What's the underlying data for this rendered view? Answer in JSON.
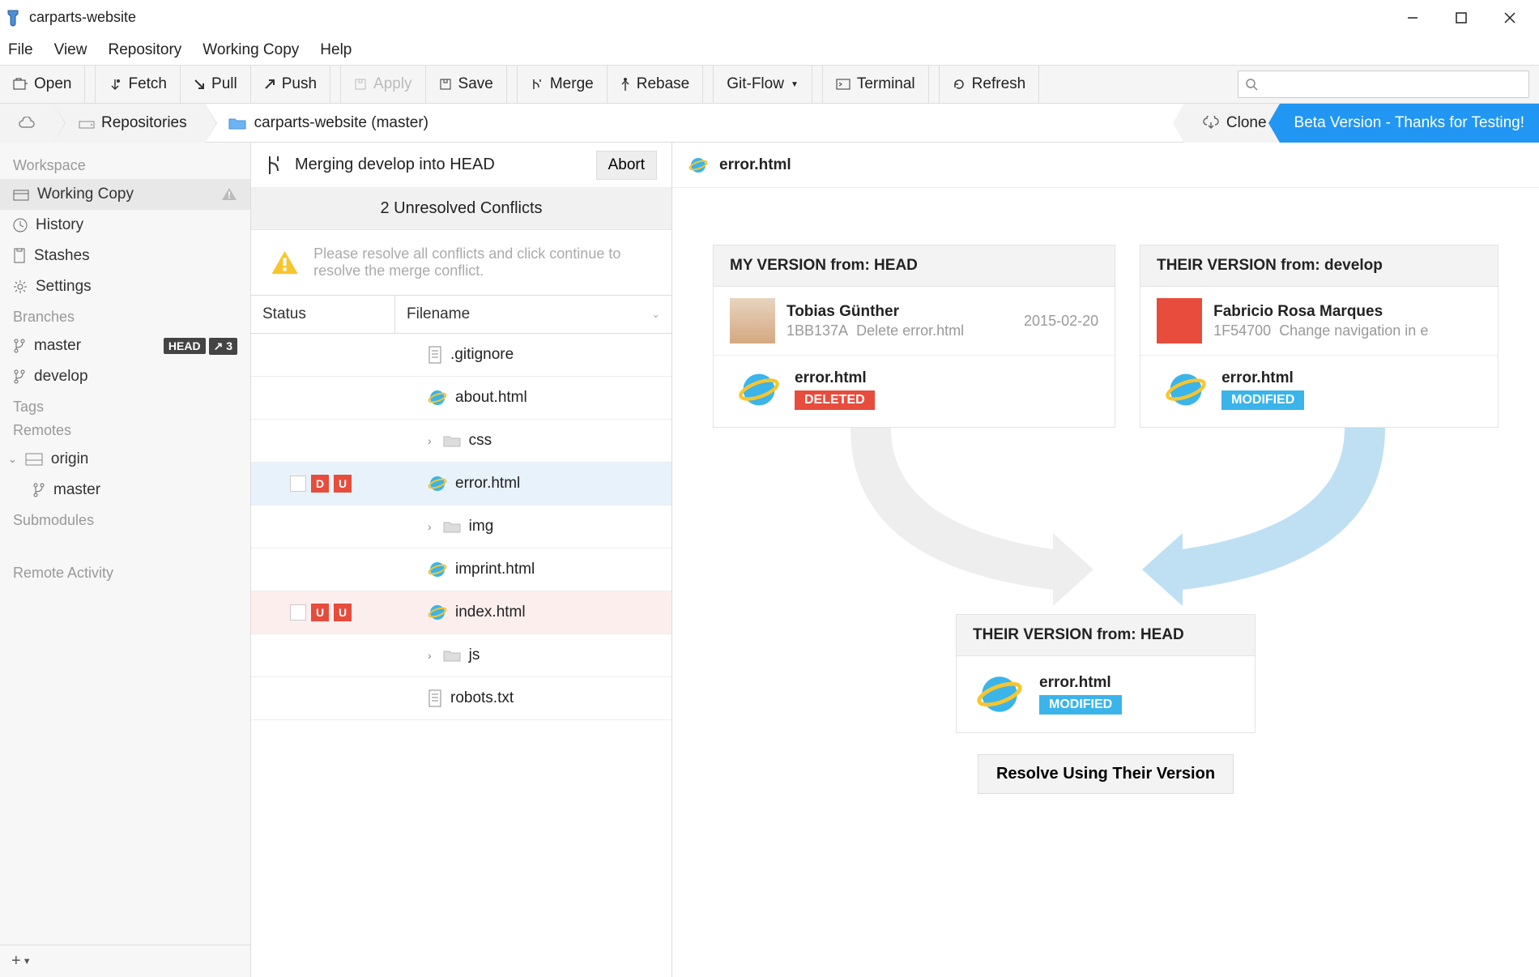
{
  "window": {
    "title": "carparts-website"
  },
  "menu": [
    "File",
    "View",
    "Repository",
    "Working Copy",
    "Help"
  ],
  "toolbar": {
    "open": "Open",
    "fetch": "Fetch",
    "pull": "Pull",
    "push": "Push",
    "apply": "Apply",
    "save": "Save",
    "merge": "Merge",
    "rebase": "Rebase",
    "gitflow": "Git-Flow",
    "terminal": "Terminal",
    "refresh": "Refresh",
    "search_placeholder": ""
  },
  "breadcrumb": {
    "repositories": "Repositories",
    "repo_label": "carparts-website (master)",
    "clone": "Clone",
    "beta": "Beta Version - Thanks for Testing!"
  },
  "sidebar": {
    "workspace": "Workspace",
    "working_copy": "Working Copy",
    "history": "History",
    "stashes": "Stashes",
    "settings": "Settings",
    "branches": "Branches",
    "branch_master": "master",
    "branch_master_head": "HEAD",
    "branch_master_count": "↗ 3",
    "branch_develop": "develop",
    "tags": "Tags",
    "remotes": "Remotes",
    "remote_origin": "origin",
    "remote_master": "master",
    "submodules": "Submodules",
    "remote_activity": "Remote Activity"
  },
  "center": {
    "merge_label": "Merging develop into HEAD",
    "abort": "Abort",
    "conflicts_title": "2 Unresolved Conflicts",
    "conflicts_msg": "Please resolve all conflicts and click continue to resolve the merge conflict.",
    "col_status": "Status",
    "col_filename": "Filename",
    "files": [
      {
        "name": ".gitignore",
        "type": "file",
        "status": []
      },
      {
        "name": "about.html",
        "type": "html",
        "status": []
      },
      {
        "name": "css",
        "type": "folder",
        "status": []
      },
      {
        "name": "error.html",
        "type": "html",
        "status": [
          "D",
          "U"
        ],
        "sel": "blue"
      },
      {
        "name": "img",
        "type": "folder",
        "status": []
      },
      {
        "name": "imprint.html",
        "type": "html",
        "status": []
      },
      {
        "name": "index.html",
        "type": "html",
        "status": [
          "U",
          "U"
        ],
        "sel": "red"
      },
      {
        "name": "js",
        "type": "folder",
        "status": []
      },
      {
        "name": "robots.txt",
        "type": "file",
        "status": []
      }
    ]
  },
  "right": {
    "filename": "error.html",
    "my": {
      "title": "MY VERSION from: HEAD",
      "author": "Tobias Günther",
      "hash": "1BB137A",
      "msg": "Delete error.html",
      "date": "2015-02-20",
      "file": "error.html",
      "status": "DELETED"
    },
    "their": {
      "title": "THEIR VERSION from: develop",
      "author": "Fabricio Rosa Marques",
      "hash": "1F54700",
      "msg": "Change navigation in e",
      "date": "",
      "file": "error.html",
      "status": "MODIFIED"
    },
    "result": {
      "title": "THEIR VERSION from: HEAD",
      "file": "error.html",
      "status": "MODIFIED"
    },
    "resolve_btn": "Resolve Using Their Version"
  }
}
